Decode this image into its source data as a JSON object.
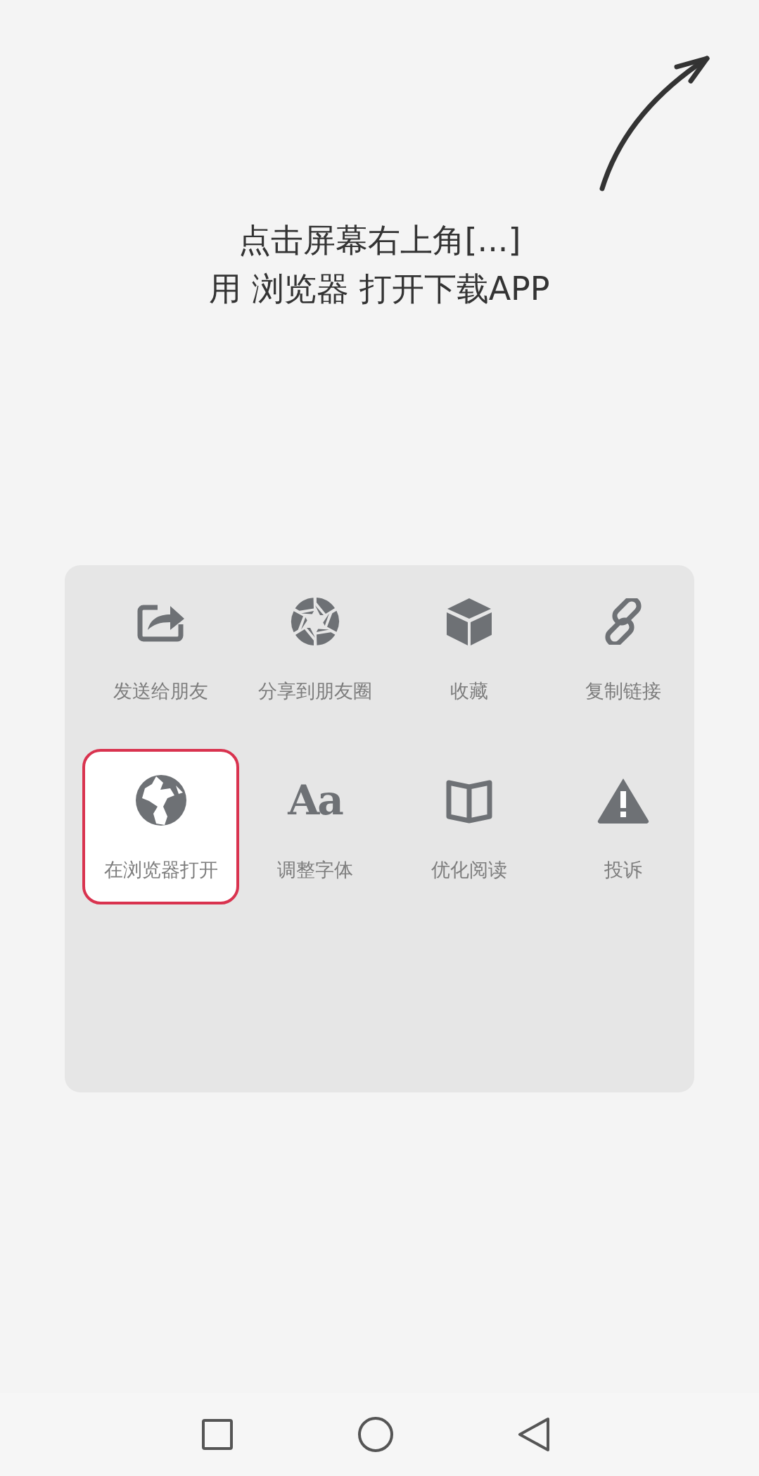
{
  "hint": {
    "lines": [
      "点击屏幕右上角[...]",
      "用 浏览器 打开下载APP"
    ]
  },
  "menu": {
    "items": [
      {
        "label": "发送给朋友",
        "kind": "share",
        "selected": false
      },
      {
        "label": "分享到朋友圈",
        "kind": "aperture",
        "selected": false
      },
      {
        "label": "收藏",
        "kind": "cube",
        "selected": false
      },
      {
        "label": "复制链接",
        "kind": "link",
        "selected": false
      },
      {
        "label": "在浏览器打开",
        "kind": "globe",
        "selected": true
      },
      {
        "label": "调整字体",
        "kind": "glyph",
        "glyph": "Aa",
        "selected": false
      },
      {
        "label": "优化阅读",
        "kind": "book",
        "selected": false
      },
      {
        "label": "投诉",
        "kind": "warning",
        "selected": false
      }
    ]
  },
  "nav_bar": {
    "buttons": [
      {
        "kind": "recents"
      },
      {
        "kind": "home"
      },
      {
        "kind": "back"
      }
    ]
  }
}
